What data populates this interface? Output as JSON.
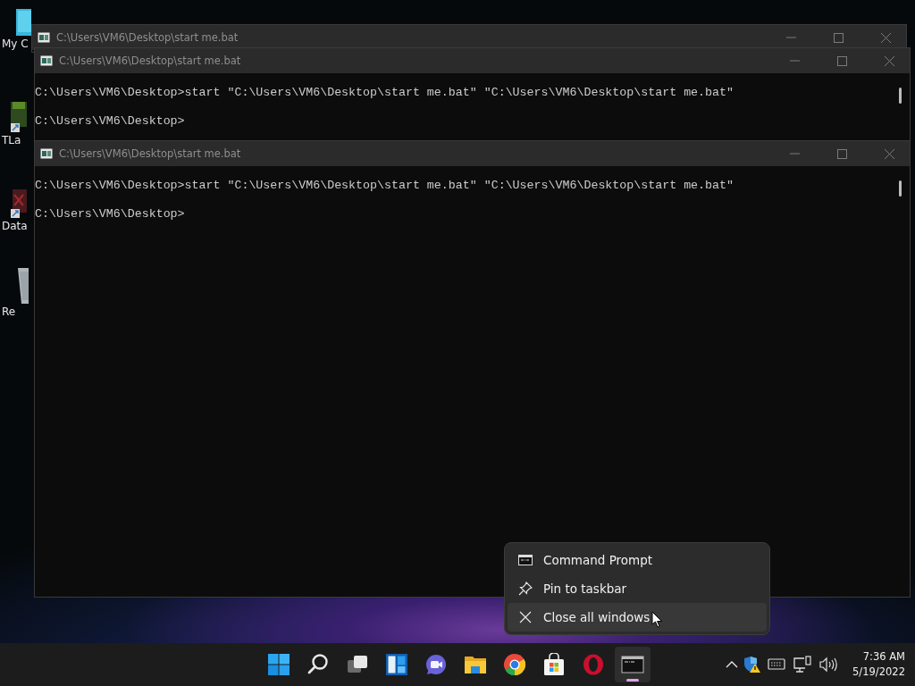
{
  "desktop_icons": [
    {
      "kind": "computer",
      "label": "My C"
    },
    {
      "kind": "game",
      "label": "TLa"
    },
    {
      "kind": "data",
      "label": "Data"
    },
    {
      "kind": "bin",
      "label": "Re"
    }
  ],
  "windows": [
    {
      "title": "C:\\Users\\VM6\\Desktop\\start me.bat"
    },
    {
      "title": "C:\\Users\\VM6\\Desktop\\start me.bat",
      "lines": [
        "C:\\Users\\VM6\\Desktop>start \"C:\\Users\\VM6\\Desktop\\start me.bat\" \"C:\\Users\\VM6\\Desktop\\start me.bat\"",
        "C:\\Users\\VM6\\Desktop>"
      ]
    },
    {
      "title": "C:\\Users\\VM6\\Desktop\\start me.bat",
      "lines": [
        "C:\\Users\\VM6\\Desktop>start \"C:\\Users\\VM6\\Desktop\\start me.bat\" \"C:\\Users\\VM6\\Desktop\\start me.bat\"",
        "C:\\Users\\VM6\\Desktop>"
      ]
    }
  ],
  "context_menu": {
    "items": [
      {
        "kind": "app",
        "label": "Command Prompt",
        "selected": false
      },
      {
        "kind": "pin",
        "label": "Pin to taskbar",
        "selected": false
      },
      {
        "kind": "close",
        "label": "Close all windows",
        "selected": true
      }
    ]
  },
  "taskbar": {
    "apps": [
      {
        "kind": "start",
        "active": false
      },
      {
        "kind": "search",
        "active": false
      },
      {
        "kind": "taskview",
        "active": false
      },
      {
        "kind": "widgets",
        "active": false
      },
      {
        "kind": "chat",
        "active": false
      },
      {
        "kind": "explorer",
        "active": false
      },
      {
        "kind": "chrome",
        "active": false
      },
      {
        "kind": "store",
        "active": false
      },
      {
        "kind": "opera",
        "active": false
      },
      {
        "kind": "terminal",
        "active": true
      }
    ],
    "clock": {
      "time": "7:36 AM",
      "date": "5/19/2022"
    }
  }
}
